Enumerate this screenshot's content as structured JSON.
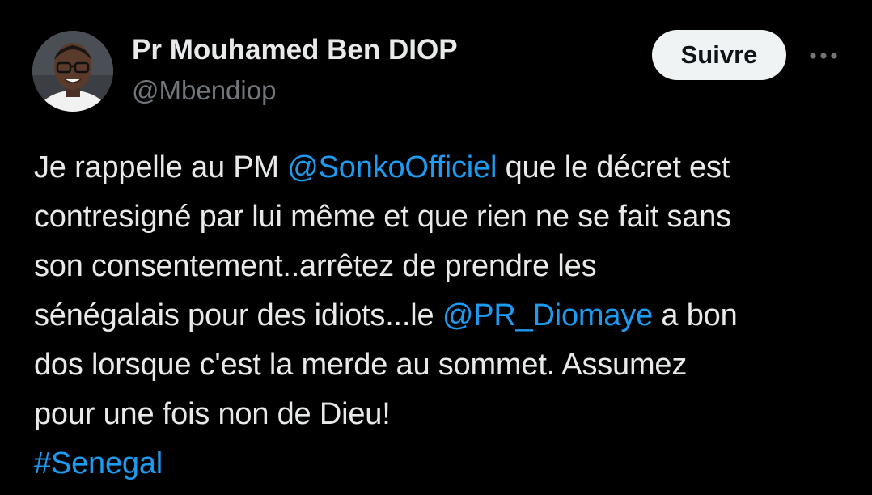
{
  "author": {
    "display_name": "Pr Mouhamed Ben DIOP",
    "handle": "@Mbendiop",
    "avatar_icon": "profile-photo"
  },
  "actions": {
    "follow_label": "Suivre",
    "more_icon": "more-horizontal-icon"
  },
  "tweet": {
    "line1_pre": "Je rappelle au PM ",
    "mention1": "@SonkoOfficiel",
    "line1_post": " que le décret est",
    "line2": "contresigné par lui même et que rien ne se fait sans",
    "line3": "son consentement..arrêtez de prendre les",
    "line4_pre": "sénégalais pour des idiots...le ",
    "mention2": "@PR_Diomaye",
    "line4_post": " a bon",
    "line5": "dos lorsque c'est la merde au sommet. Assumez",
    "line6": "pour une fois non de Dieu!",
    "hashtag": "#Senegal"
  },
  "colors": {
    "background": "#000000",
    "text": "#e7e9ea",
    "secondary_text": "#71767b",
    "link": "#1d9bf0",
    "follow_button_bg": "#eff3f4"
  }
}
